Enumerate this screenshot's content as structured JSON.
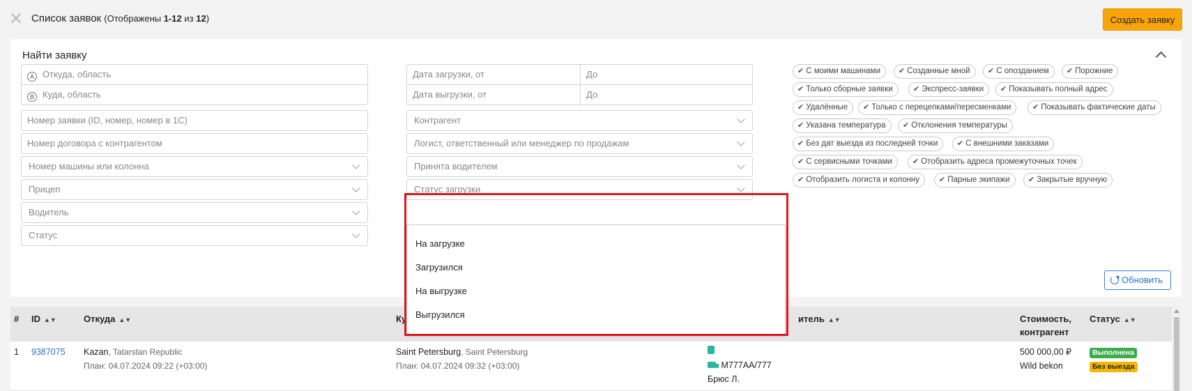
{
  "header": {
    "title": "Список заявок",
    "count_prefix": "(Отображены ",
    "count_range": "1-12",
    "count_mid": " из ",
    "count_total": "12",
    "count_suffix": ")",
    "create_button": "Создать заявку"
  },
  "filters": {
    "title": "Найти заявку",
    "from_letter": "A",
    "from_placeholder": "Откуда, область",
    "to_letter": "B",
    "to_placeholder": "Куда, область",
    "load_date_from": "Дата загрузки, от",
    "load_date_to": "До",
    "unload_date_from": "Дата выгрузки, от",
    "unload_date_to": "До",
    "order_number": "Номер заявки (ID, номер, номер в 1С)",
    "contractor": "Контрагент",
    "contract_number": "Номер договора с контрагентом",
    "logist": "Логист, ответственный или менеджер по продажам",
    "vehicle": "Номер машины или колонна",
    "accepted_by_driver": "Принята водителем",
    "trailer": "Прицеп",
    "load_status": "Статус загрузки",
    "driver": "Водитель",
    "status": "Статус",
    "refresh_button": "Обновить",
    "tags": [
      "С моими машинами",
      "Созданные мной",
      "С опозданием",
      "Порожние",
      "Только сборные заявки",
      "Экспресс-заявки",
      "Показывать полный адрес",
      "Удалённые",
      "Только с перецепками/пересменками",
      "Показывать фактические даты",
      "Указана температура",
      "Отклонения температуры",
      "Без дат выезда из последней точки",
      "С внешними заказами",
      "С сервисными точками",
      "Отобразить адреса промежуточных точек",
      "Отобразить логиста и колонну",
      "Парные экипажи",
      "Закрытые вручную"
    ]
  },
  "dropdown": {
    "options": [
      "На загрузке",
      "Загрузился",
      "На выгрузке",
      "Выгрузился"
    ]
  },
  "table": {
    "headers": {
      "num": "#",
      "id": "ID",
      "from": "Откуда",
      "to": "Ку",
      "driver": "итель",
      "cost_line1": "Стоимость,",
      "cost_line2": "контрагент",
      "status": "Статус"
    },
    "rows": [
      {
        "num": "1",
        "id": "9387075",
        "from_city": "Kazan",
        "from_region": ", Tatarstan Republic",
        "from_plan": "План: 04.07.2024 09:22 (+03:00)",
        "to_city": "Saint Petersburg",
        "to_region": ", Saint Petersburg",
        "to_plan": "План: 04.07.2024 09:32 (+03:00)",
        "vehicle": "M777AA/777",
        "driver": "Брюс Л.",
        "cost": "500 000,00 ₽",
        "contractor": "Wild bekon",
        "status_badge": "Выполнена",
        "extra_badge": "Без выезда"
      }
    ]
  },
  "colors": {
    "accent": "#f8a50b",
    "link": "#2a6fc9",
    "highlight": "#e0161f",
    "badge_done": "#3cab4a",
    "badge_warn": "#f5b800"
  }
}
